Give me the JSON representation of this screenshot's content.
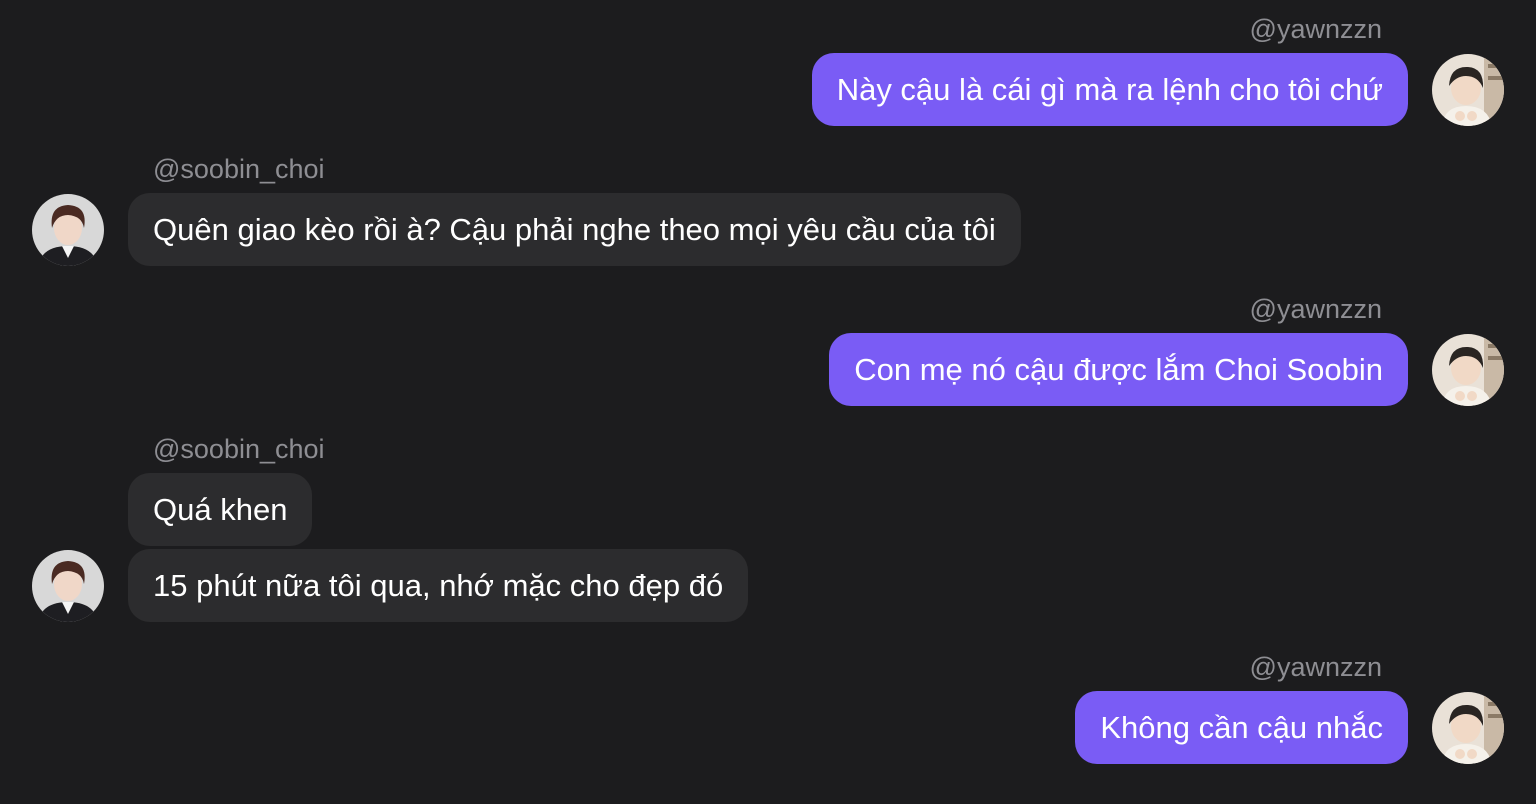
{
  "conversation": {
    "messages": [
      {
        "sender": "@yawnzzn",
        "side": "right",
        "text": "Này cậu là cái gì mà ra lệnh cho tôi chứ"
      },
      {
        "sender": "@soobin_choi",
        "side": "left",
        "text": "Quên giao kèo rồi à? Cậu phải nghe theo mọi yêu cầu của tôi"
      },
      {
        "sender": "@yawnzzn",
        "side": "right",
        "text": "Con mẹ nó cậu được lắm Choi  Soobin"
      },
      {
        "sender": "@soobin_choi",
        "side": "left",
        "text": "Quá khen"
      },
      {
        "sender": "@soobin_choi",
        "side": "left",
        "text": "15 phút nữa tôi qua, nhớ mặc cho đẹp đó"
      },
      {
        "sender": "@yawnzzn",
        "side": "right",
        "text": "Không cần cậu nhắc"
      }
    ]
  },
  "colors": {
    "background": "#1c1c1e",
    "outgoing_bubble": "#7a5cf5",
    "incoming_bubble": "#2c2c2e",
    "username_text": "#8e8e93"
  },
  "icons": {
    "outgoing_avatar": "user-avatar-photo",
    "incoming_avatar": "user-avatar-photo"
  }
}
